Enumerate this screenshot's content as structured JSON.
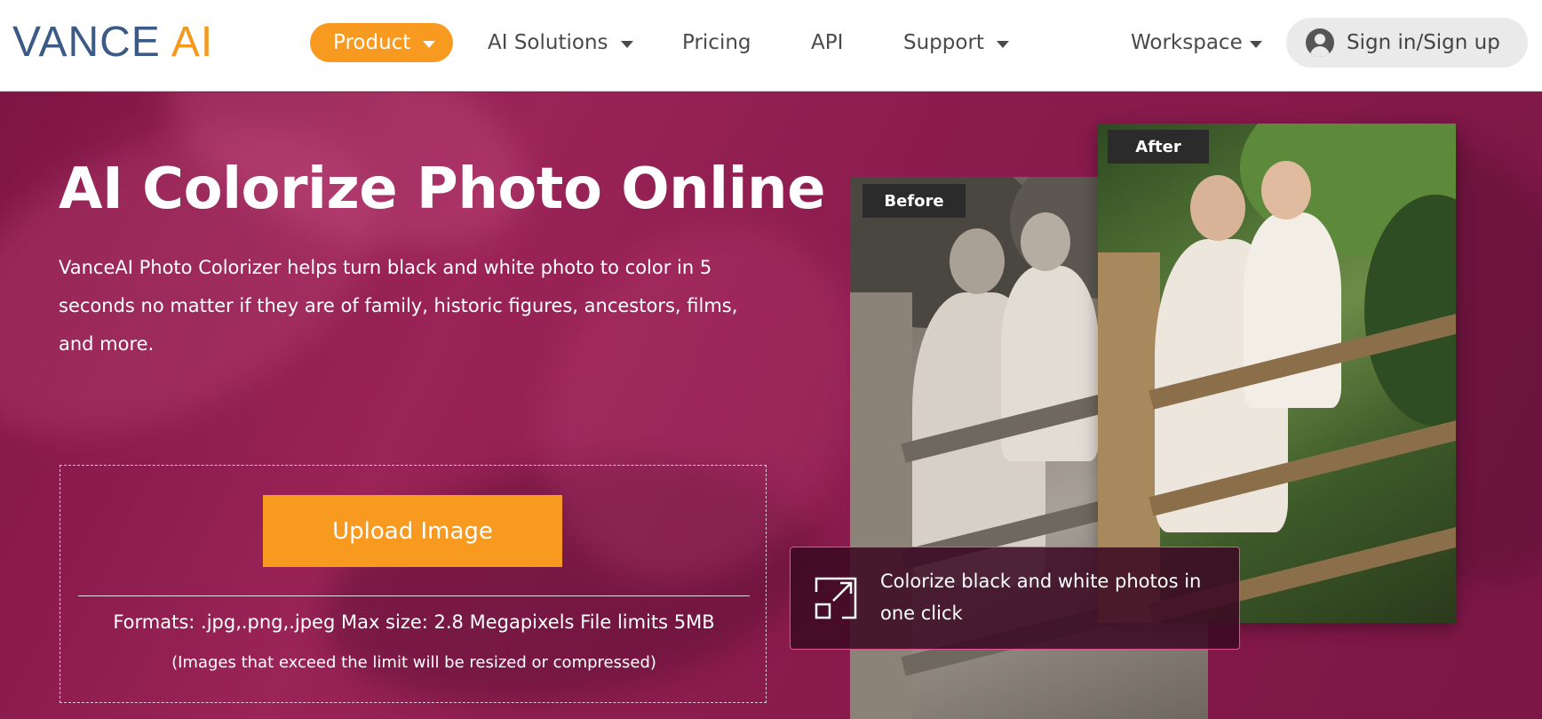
{
  "header": {
    "logo": {
      "part1": "VANCE",
      "part2": "AI"
    },
    "nav": [
      {
        "label": "Product",
        "has_dropdown": true,
        "active": true
      },
      {
        "label": "AI Solutions",
        "has_dropdown": true
      },
      {
        "label": "Pricing",
        "has_dropdown": false
      },
      {
        "label": "API",
        "has_dropdown": false
      },
      {
        "label": "Support",
        "has_dropdown": true
      }
    ],
    "workspace": {
      "label": "Workspace",
      "has_dropdown": true
    },
    "signin": {
      "label": "Sign in/Sign up",
      "icon": "user-icon"
    }
  },
  "hero": {
    "title": "AI Colorize Photo Online",
    "description": "VanceAI Photo Colorizer helps turn black and white photo to color in 5 seconds no matter if they are of family, historic figures, ancestors, films, and more.",
    "upload": {
      "button_label": "Upload Image",
      "formats": "Formats: .jpg,.png,.jpeg Max size: 2.8 Megapixels File limits 5MB",
      "note": "(Images that exceed the limit will be resized or compressed)"
    },
    "comparison": {
      "before_label": "Before",
      "after_label": "After",
      "caption": "Colorize black and white photos in one click",
      "caption_icon": "expand-icon"
    }
  },
  "colors": {
    "brand_orange": "#f79a1f",
    "logo_blue": "#3b5a86",
    "hero_background": "#8e1a4a",
    "caption_border": "#e0558f"
  }
}
